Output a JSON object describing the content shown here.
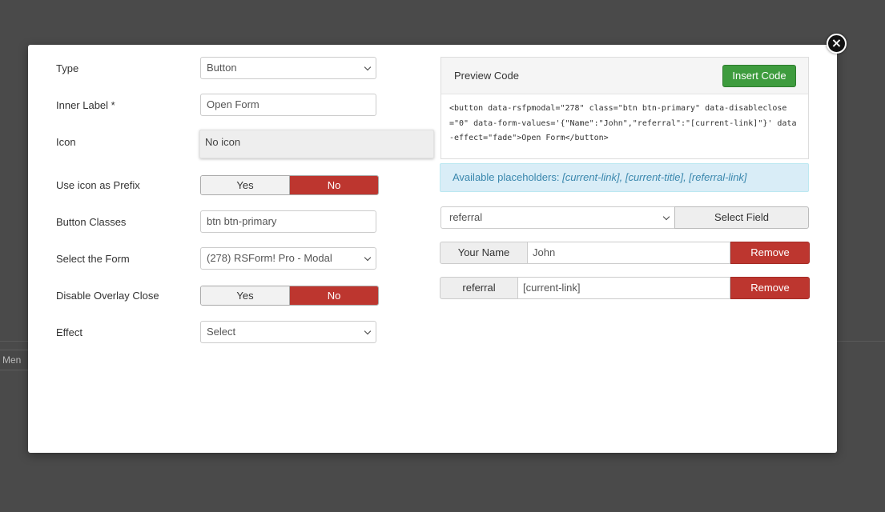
{
  "background": {
    "menu_tab_label": "Men"
  },
  "modal": {
    "close_icon": "close-icon",
    "form": {
      "type": {
        "label": "Type",
        "value": "Button"
      },
      "inner_label": {
        "label": "Inner Label *",
        "value": "Open Form"
      },
      "icon": {
        "label": "Icon",
        "value": "No icon"
      },
      "icon_prefix": {
        "label": "Use icon as Prefix",
        "yes": "Yes",
        "no": "No",
        "selected": "No"
      },
      "button_classes": {
        "label": "Button Classes",
        "value": "btn btn-primary"
      },
      "select_form": {
        "label": "Select the Form",
        "value": "(278) RSForm! Pro - Modal"
      },
      "disable_overlay": {
        "label": "Disable Overlay Close",
        "yes": "Yes",
        "no": "No",
        "selected": "No"
      },
      "effect": {
        "label": "Effect",
        "value": "Select"
      }
    },
    "preview": {
      "title": "Preview Code",
      "insert_label": "Insert Code",
      "code": "<button data-rsfpmodal=\"278\" class=\"btn btn-primary\" data-disableclose=\"0\" data-form-values='{\"Name\":\"John\",\"referral\":\"[current-link]\"}' data-effect=\"fade\">Open Form</button>"
    },
    "placeholders": {
      "label": "Available placeholders:",
      "items": "[current-link], [current-title], [referral-link]"
    },
    "field_select": {
      "value": "referral",
      "button_label": "Select Field"
    },
    "values": [
      {
        "name": "Your Name",
        "value": "John",
        "remove_label": "Remove"
      },
      {
        "name": "referral",
        "value": "[current-link]",
        "remove_label": "Remove"
      }
    ],
    "colors": {
      "danger": "#bd362f",
      "success": "#3e9c3e",
      "info_bg": "#d9edf7"
    }
  }
}
